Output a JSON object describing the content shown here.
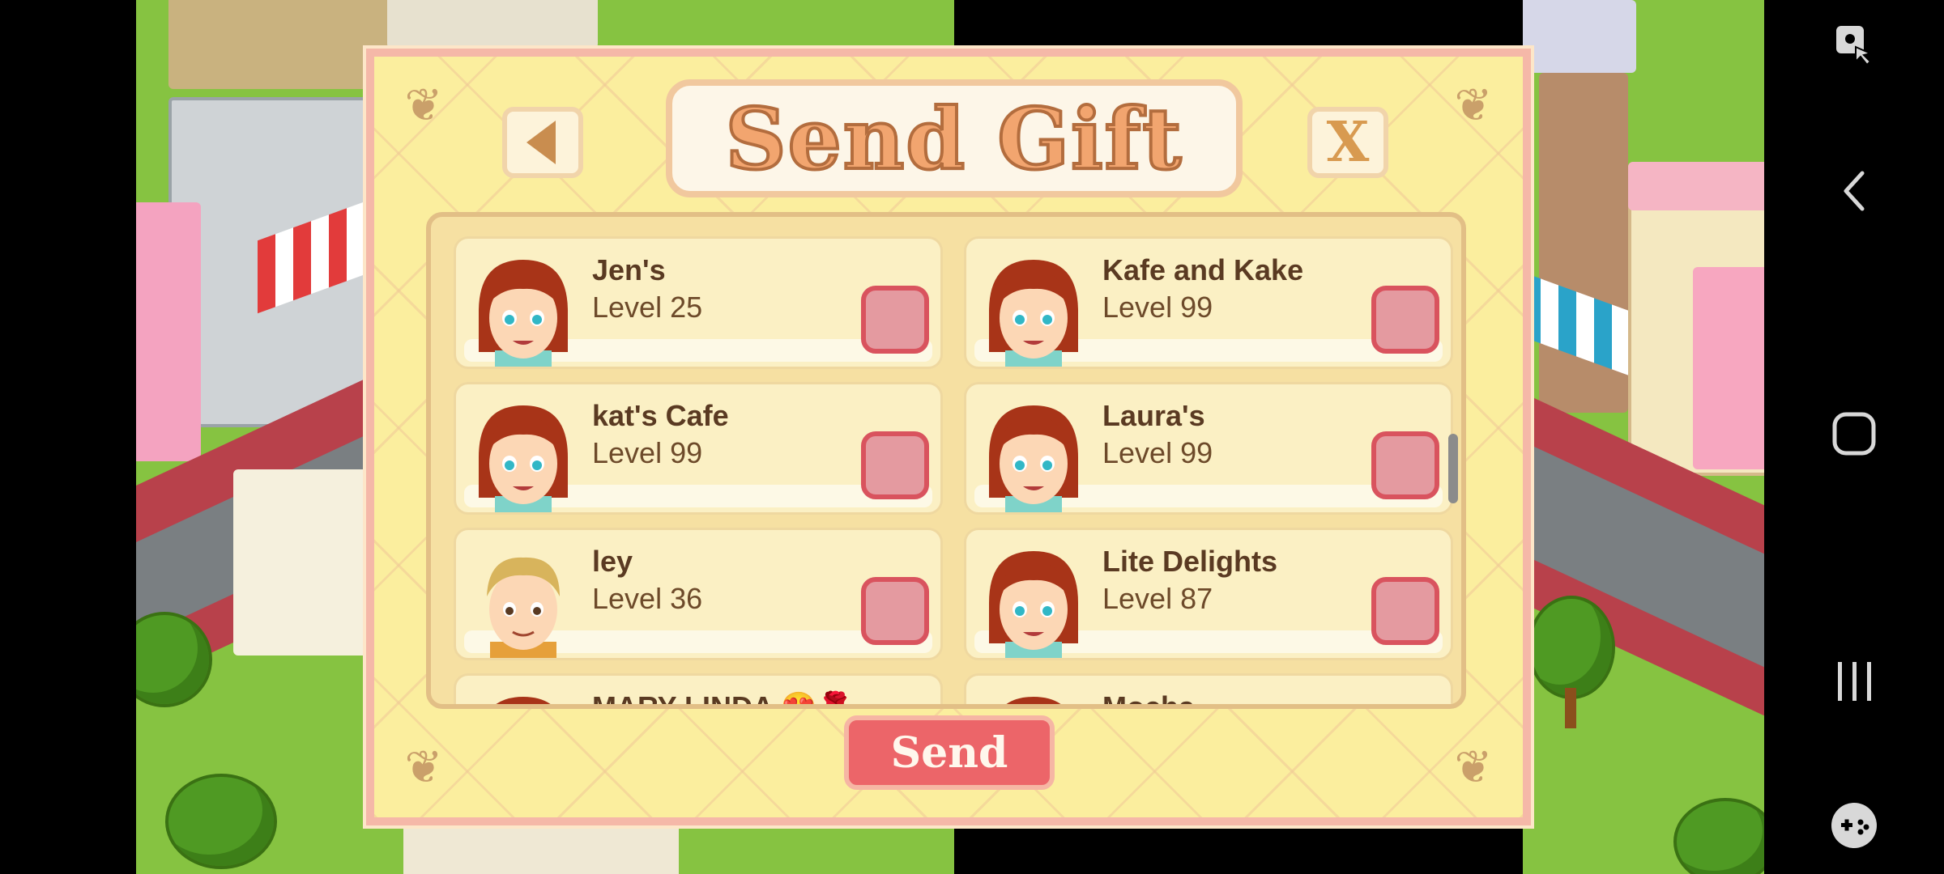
{
  "dialog": {
    "title": "Send Gift",
    "close_label": "X",
    "send_label": "Send"
  },
  "friends": [
    {
      "name": "Jen's",
      "level": "Level 25",
      "avatar": "girl-avatar",
      "checked": false
    },
    {
      "name": "Kafe and Kake",
      "level": "Level 99",
      "avatar": "girl-avatar",
      "checked": false
    },
    {
      "name": "kat's Cafe",
      "level": "Level 99",
      "avatar": "girl-avatar",
      "checked": false
    },
    {
      "name": "Laura's",
      "level": "Level 99",
      "avatar": "girl-avatar",
      "checked": false
    },
    {
      "name": "ley",
      "level": "Level 36",
      "avatar": "boy-avatar",
      "checked": false
    },
    {
      "name": "Lite Delights",
      "level": "Level 87",
      "avatar": "girl-avatar",
      "checked": false
    },
    {
      "name": "MARY LINDA 😍🌹",
      "level": "",
      "avatar": "girl-avatar",
      "checked": false
    },
    {
      "name": "Mocha",
      "level": "",
      "avatar": "girl-avatar",
      "checked": false
    }
  ],
  "colors": {
    "dialog_bg": "#fbee9e",
    "dialog_border": "#f5b8a8",
    "checkbox_fill": "#e49aa0",
    "checkbox_border": "#d9535e",
    "send_button": "#ec6569",
    "title_text": "#f2a56f"
  },
  "system_nav": {
    "icons": [
      "touch-lock-icon",
      "back-icon",
      "home-icon",
      "recent-apps-icon",
      "game-controller-icon"
    ]
  }
}
